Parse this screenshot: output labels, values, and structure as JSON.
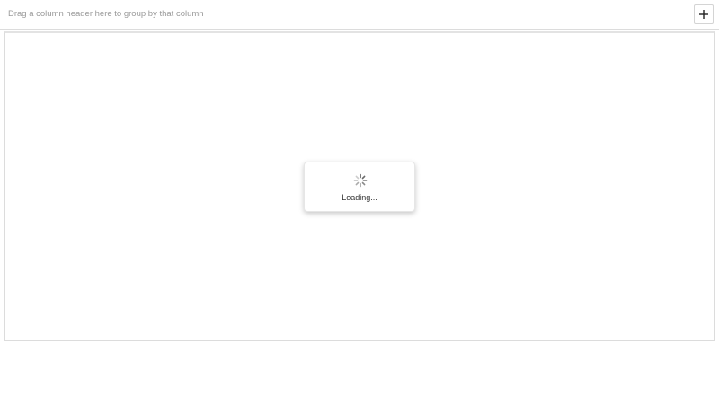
{
  "group_panel": {
    "hint": "Drag a column header here to group by that column",
    "add_icon": "plus-icon"
  },
  "load_panel": {
    "text": "Loading...",
    "spinner_icon": "spinner-icon"
  },
  "colors": {
    "border": "#dcdcdc",
    "hint_text": "#9a9a9a",
    "spinner": "#5a5a5a"
  }
}
